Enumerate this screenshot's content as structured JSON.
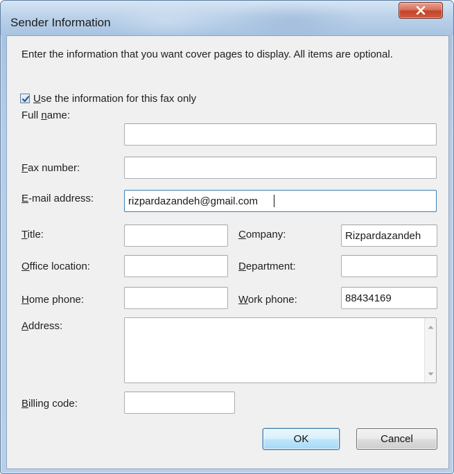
{
  "window": {
    "title": "Sender Information",
    "close_icon": "close-x-icon"
  },
  "intro_text": "Enter the information that you want cover pages to display. All items are optional.",
  "checkbox": {
    "label_mnemonic": "U",
    "label_rest": "se the information for this fax only",
    "checked": true
  },
  "fields": {
    "full_name": {
      "label_pre": "Full ",
      "label_mn": "n",
      "label_post": "ame:",
      "value": ""
    },
    "fax_number": {
      "label_pre": "",
      "label_mn": "F",
      "label_post": "ax number:",
      "value": ""
    },
    "email": {
      "label_pre": "",
      "label_mn": "E",
      "label_post": "-mail address:",
      "value": "rizpardazandeh@gmail.com"
    },
    "title": {
      "label_pre": "",
      "label_mn": "T",
      "label_post": "itle:",
      "value": ""
    },
    "company": {
      "label_pre": "",
      "label_mn": "C",
      "label_post": "ompany:",
      "value": "Rizpardazandeh"
    },
    "office_location": {
      "label_pre": "",
      "label_mn": "O",
      "label_post": "ffice location:",
      "value": ""
    },
    "department": {
      "label_pre": "",
      "label_mn": "D",
      "label_post": "epartment:",
      "value": ""
    },
    "home_phone": {
      "label_pre": "",
      "label_mn": "H",
      "label_post": "ome phone:",
      "value": ""
    },
    "work_phone": {
      "label_pre": "",
      "label_mn": "W",
      "label_post": "ork phone:",
      "value": "88434169"
    },
    "address": {
      "label_pre": "",
      "label_mn": "A",
      "label_post": "ddress:",
      "value": ""
    },
    "billing_code": {
      "label_pre": "",
      "label_mn": "B",
      "label_post": "illing code:",
      "value": ""
    }
  },
  "buttons": {
    "ok": "OK",
    "cancel": "Cancel"
  }
}
